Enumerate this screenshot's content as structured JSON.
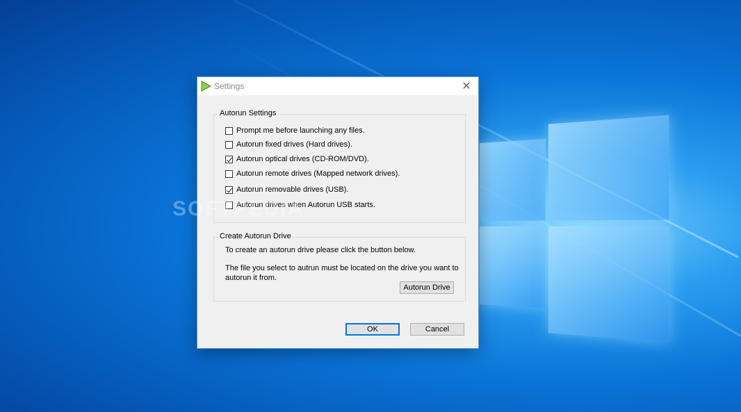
{
  "dialog": {
    "title": "Settings",
    "close_glyph": "✕",
    "autorun_settings": {
      "label": "Autorun Settings",
      "options": [
        {
          "label": "Prompt me before launching any files.",
          "checked": false
        },
        {
          "label": "Autorun fixed drives (Hard drives).",
          "checked": false
        },
        {
          "label": "Autorun optical drives (CD-ROM/DVD).",
          "checked": true
        },
        {
          "label": "Autorun remote drives (Mapped network drives).",
          "checked": false
        },
        {
          "label": "Autorun removable drives (USB).",
          "checked": true
        },
        {
          "label": "Autorun drives when Autorun USB starts.",
          "checked": false
        }
      ]
    },
    "create_drive": {
      "label": "Create Autorun Drive",
      "line1": "To create an autorun drive please click the button below.",
      "line2a": "The file you select to autrun must be located on the drive you want to",
      "line2b": "autorun it from.",
      "button": "Autorun Drive"
    },
    "ok_label": "OK",
    "cancel_label": "Cancel"
  },
  "watermark": "SOFTPEDIA",
  "colors": {
    "accent": "#0078d7",
    "desktop": "#0a74d8"
  }
}
